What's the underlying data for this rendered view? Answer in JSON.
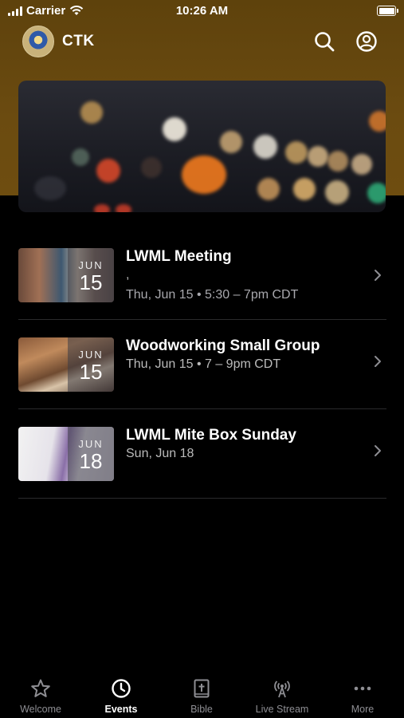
{
  "status_bar": {
    "carrier": "Carrier",
    "time": "10:26 AM"
  },
  "app": {
    "title": "CTK"
  },
  "events": [
    {
      "title": "LWML Meeting",
      "location": ",",
      "when": "Thu, Jun 15 • 5:30 – 7pm CDT",
      "month": "JUN",
      "day": "15"
    },
    {
      "title": "Woodworking Small Group",
      "location": "",
      "when": "Thu, Jun 15 • 7 – 9pm CDT",
      "month": "JUN",
      "day": "15"
    },
    {
      "title": "LWML Mite Box Sunday",
      "location": "",
      "when": "Sun, Jun 18",
      "month": "JUN",
      "day": "18"
    }
  ],
  "tabs": [
    {
      "label": "Welcome",
      "icon": "star-icon"
    },
    {
      "label": "Events",
      "icon": "clock-icon",
      "active": true
    },
    {
      "label": "Bible",
      "icon": "bible-icon"
    },
    {
      "label": "Live Stream",
      "icon": "broadcast-icon"
    },
    {
      "label": "More",
      "icon": "more-icon"
    }
  ],
  "colors": {
    "header": "#6b4b10",
    "background": "#000000"
  }
}
